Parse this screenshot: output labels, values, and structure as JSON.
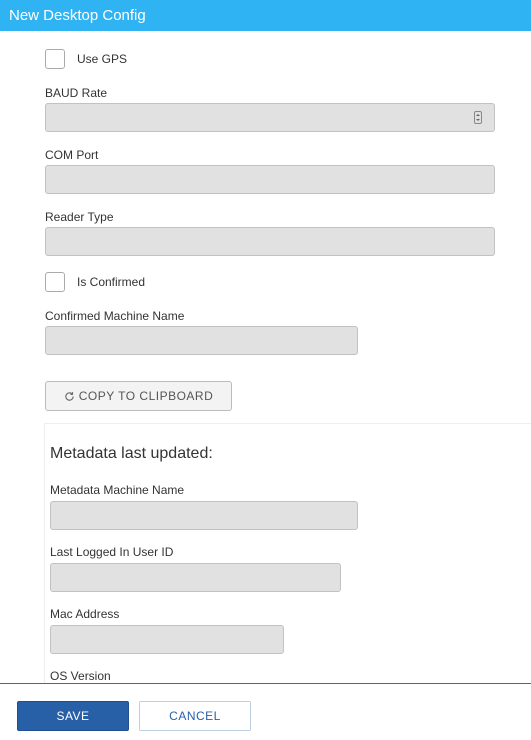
{
  "window": {
    "title": "New Desktop Config"
  },
  "form": {
    "use_gps": {
      "label": "Use GPS",
      "checked": false
    },
    "baud_rate": {
      "label": "BAUD Rate",
      "value": ""
    },
    "com_port": {
      "label": "COM Port",
      "value": ""
    },
    "reader_type": {
      "label": "Reader Type",
      "value": ""
    },
    "is_confirmed": {
      "label": "Is Confirmed",
      "checked": false
    },
    "confirmed_machine_name": {
      "label": "Confirmed Machine Name",
      "value": ""
    },
    "copy_button": {
      "label": "COPY TO CLIPBOARD",
      "icon": "refresh-icon"
    }
  },
  "metadata": {
    "heading": "Metadata last updated:",
    "machine_name": {
      "label": "Metadata Machine Name",
      "value": ""
    },
    "last_logged_in_user_id": {
      "label": "Last Logged In User ID",
      "value": ""
    },
    "mac_address": {
      "label": "Mac Address",
      "value": ""
    },
    "os_version": {
      "label": "OS Version"
    }
  },
  "footer": {
    "save_label": "SAVE",
    "cancel_label": "CANCEL"
  },
  "colors": {
    "titlebar": "#2fb3f3",
    "primary": "#2860a8",
    "input_bg": "#e1e1e1"
  }
}
